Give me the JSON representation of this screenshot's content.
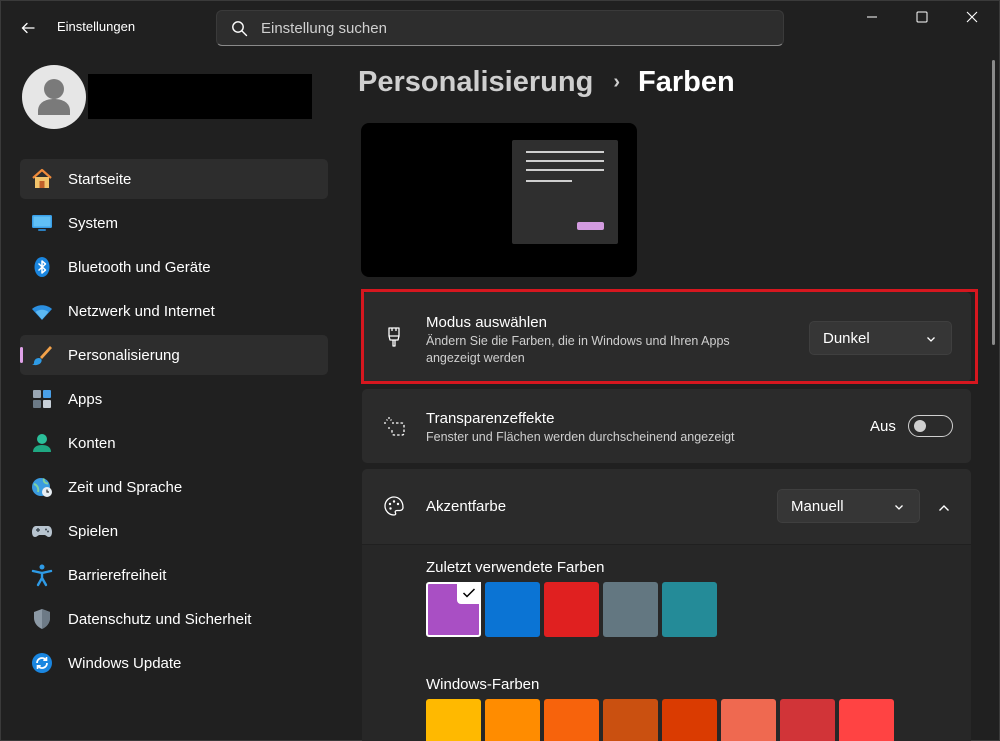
{
  "window": {
    "title": "Einstellungen",
    "controls": [
      "minimize",
      "maximize",
      "close"
    ]
  },
  "search": {
    "placeholder": "Einstellung suchen"
  },
  "sidebar": {
    "items": [
      {
        "label": "Startseite",
        "icon": "home-icon"
      },
      {
        "label": "System",
        "icon": "monitor-icon"
      },
      {
        "label": "Bluetooth und Geräte",
        "icon": "bluetooth-icon"
      },
      {
        "label": "Netzwerk und Internet",
        "icon": "wifi-icon"
      },
      {
        "label": "Personalisierung",
        "icon": "paintbrush-icon",
        "active": true
      },
      {
        "label": "Apps",
        "icon": "apps-icon"
      },
      {
        "label": "Konten",
        "icon": "account-icon"
      },
      {
        "label": "Zeit und Sprache",
        "icon": "globe-clock-icon"
      },
      {
        "label": "Spielen",
        "icon": "gamepad-icon"
      },
      {
        "label": "Barrierefreiheit",
        "icon": "accessibility-icon"
      },
      {
        "label": "Datenschutz und Sicherheit",
        "icon": "shield-icon"
      },
      {
        "label": "Windows Update",
        "icon": "update-icon"
      }
    ]
  },
  "breadcrumb": {
    "parent": "Personalisierung",
    "separator": "›",
    "current": "Farben"
  },
  "mode": {
    "title": "Modus auswählen",
    "description": "Ändern Sie die Farben, die in Windows und Ihren Apps angezeigt werden",
    "value": "Dunkel"
  },
  "transparency": {
    "title": "Transparenzeffekte",
    "description": "Fenster und Flächen werden durchscheinend angezeigt",
    "state_label": "Aus",
    "on": false
  },
  "accent": {
    "title": "Akzentfarbe",
    "value": "Manuell",
    "recent_label": "Zuletzt verwendete Farben",
    "recent_colors": [
      "#a94fc4",
      "#0b74d4",
      "#e02020",
      "#637781",
      "#248b98"
    ],
    "selected_index": 0,
    "windows_label": "Windows-Farben",
    "windows_colors": [
      "#ffb900",
      "#ff8c00",
      "#f7630c",
      "#ca5010",
      "#da3b01",
      "#ef6950",
      "#d13438",
      "#ff4343"
    ]
  },
  "colors": {
    "accent": "#e0a2e8",
    "highlight_border": "#d6171f"
  }
}
